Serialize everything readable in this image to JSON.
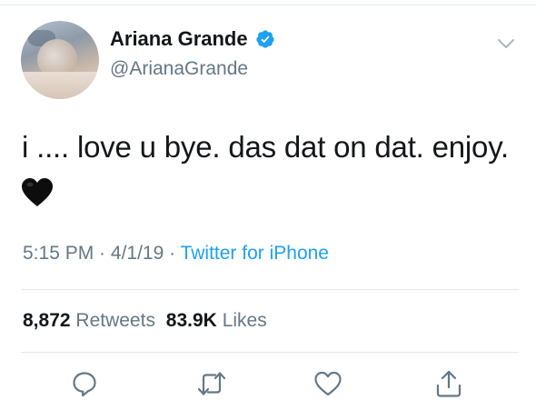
{
  "user": {
    "display_name": "Ariana Grande",
    "handle": "@ArianaGrande",
    "verified": true,
    "avatar_icon": "avatar-photo"
  },
  "tweet": {
    "text": "i .... love u bye. das dat on dat. enjoy.",
    "emoji": "black-heart-emoji"
  },
  "meta": {
    "time": "5:15 PM",
    "sep1": " · ",
    "date": "4/1/19",
    "sep2": " · ",
    "source": "Twitter for iPhone"
  },
  "stats": {
    "retweets_count": "8,872",
    "retweets_label": "Retweets",
    "likes_count": "83.9K",
    "likes_label": "Likes"
  },
  "actions": [
    {
      "name": "reply",
      "icon": "reply-icon"
    },
    {
      "name": "retweet",
      "icon": "retweet-icon"
    },
    {
      "name": "like",
      "icon": "heart-icon"
    },
    {
      "name": "share",
      "icon": "share-icon"
    }
  ],
  "colors": {
    "accent": "#1da1f2",
    "text": "#14171a",
    "secondary": "#657786",
    "divider": "#e1e8ed"
  }
}
